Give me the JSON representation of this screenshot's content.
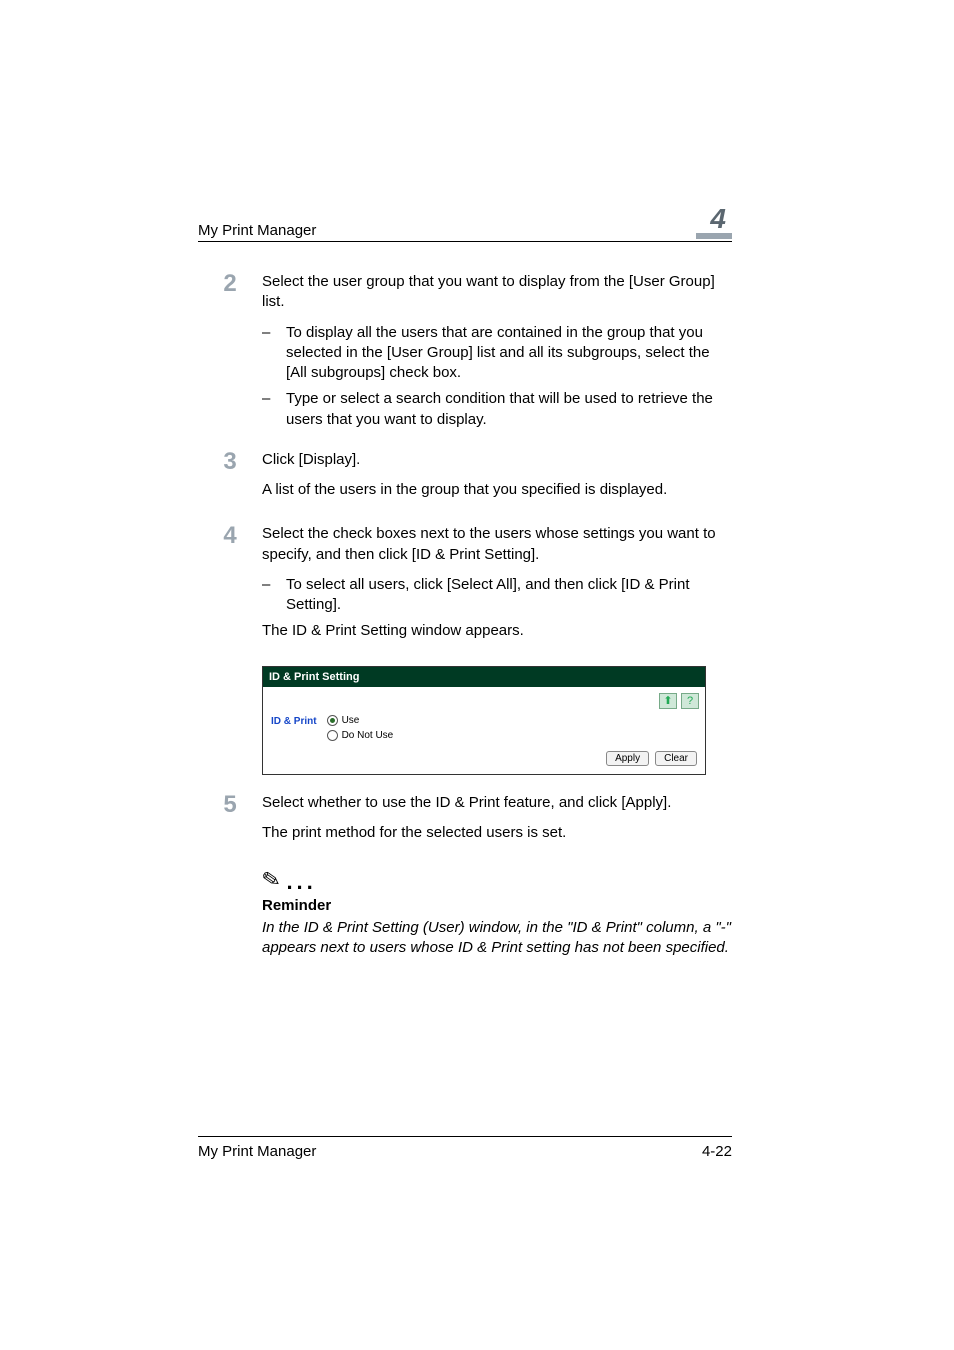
{
  "header": {
    "title": "My Print Manager",
    "chapter_number": "4"
  },
  "steps": {
    "s2": {
      "num": "2",
      "text": "Select the user group that you want to display from the [User Group] list.",
      "bullets": [
        "To display all the users that are contained in the group that you selected in the [User Group] list and all its subgroups, select the [All subgroups] check box.",
        "Type or select a search condition that will be used to retrieve the users that you want to display."
      ]
    },
    "s3": {
      "num": "3",
      "line1": "Click [Display].",
      "line2": "A list of the users in the group that you specified is displayed."
    },
    "s4": {
      "num": "4",
      "line1": "Select the check boxes next to the users whose settings you want to specify, and then click [ID & Print Setting].",
      "bullet": "To select all users, click [Select All], and then click [ID & Print Setting].",
      "line2": "The ID & Print Setting window appears."
    },
    "s5": {
      "num": "5",
      "line1": "Select whether to use the ID & Print feature, and click [Apply].",
      "line2": "The print method for the selected users is set."
    }
  },
  "screenshot": {
    "window_title": "ID & Print Setting",
    "label": "ID & Print",
    "option_use": "Use",
    "option_do_not_use": "Do Not Use",
    "icon_back": "⬆",
    "icon_help": "?",
    "btn_apply": "Apply",
    "btn_clear": "Clear"
  },
  "reminder": {
    "heading": "Reminder",
    "text": "In the ID & Print Setting (User) window, in the \"ID & Print\" column, a \"-\" appears next to users whose ID & Print setting has not been specified."
  },
  "footer": {
    "left": "My Print Manager",
    "right": "4-22"
  }
}
